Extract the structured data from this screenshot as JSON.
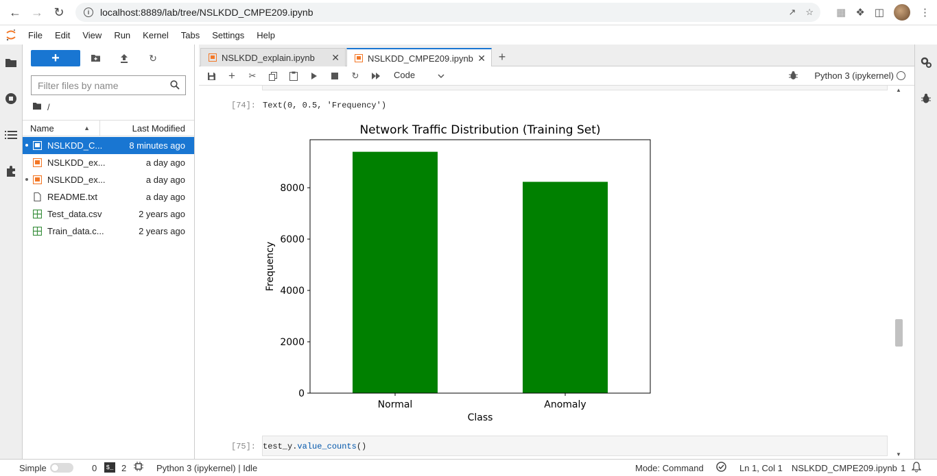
{
  "browser": {
    "url": "localhost:8889/lab/tree/NSLKDD_CMPE209.ipynb"
  },
  "menu": [
    "File",
    "Edit",
    "View",
    "Run",
    "Kernel",
    "Tabs",
    "Settings",
    "Help"
  ],
  "filebrowser": {
    "filter_placeholder": "Filter files by name",
    "path": "/",
    "col_name": "Name",
    "col_modified": "Last Modified",
    "files": [
      {
        "name": "NSLKDD_C...",
        "modified": "8 minutes ago",
        "type": "notebook",
        "running": true,
        "selected": true
      },
      {
        "name": "NSLKDD_ex...",
        "modified": "a day ago",
        "type": "notebook",
        "running": false,
        "selected": false
      },
      {
        "name": "NSLKDD_ex...",
        "modified": "a day ago",
        "type": "notebook",
        "running": true,
        "selected": false
      },
      {
        "name": "README.txt",
        "modified": "a day ago",
        "type": "text",
        "running": false,
        "selected": false
      },
      {
        "name": "Test_data.csv",
        "modified": "2 years ago",
        "type": "csv",
        "running": false,
        "selected": false
      },
      {
        "name": "Train_data.c...",
        "modified": "2 years ago",
        "type": "csv",
        "running": false,
        "selected": false
      }
    ]
  },
  "tabs": [
    {
      "label": "NSLKDD_explain.ipynb",
      "active": false
    },
    {
      "label": "NSLKDD_CMPE209.ipynb",
      "active": true
    }
  ],
  "toolbar": {
    "cell_type": "Code",
    "kernel": "Python 3 (ipykernel)"
  },
  "cells": {
    "out_prompt": "[74]:",
    "out_text": "Text(0, 0.5, 'Frequency')",
    "next_prompt": "[75]:",
    "next_code_obj": "test_y",
    "next_code_dot": ".",
    "next_code_method": "value_counts",
    "next_code_tail": "()"
  },
  "chart_data": {
    "type": "bar",
    "title": "Network Traffic Distribution (Training Set)",
    "xlabel": "Class",
    "ylabel": "Frequency",
    "categories": [
      "Normal",
      "Anomaly"
    ],
    "values": [
      9400,
      8230
    ],
    "yticks": [
      0,
      2000,
      4000,
      6000,
      8000
    ],
    "ylim": [
      0,
      9870
    ],
    "bar_color": "#008000",
    "grid": false
  },
  "status": {
    "mode_label": "Simple",
    "terminals": "0",
    "kernels": "2",
    "kernel_status": "Python 3 (ipykernel) | Idle",
    "command_mode": "Mode: Command",
    "cursor": "Ln 1, Col 1",
    "filename": "NSLKDD_CMPE209.ipynb",
    "notifications": "1"
  }
}
